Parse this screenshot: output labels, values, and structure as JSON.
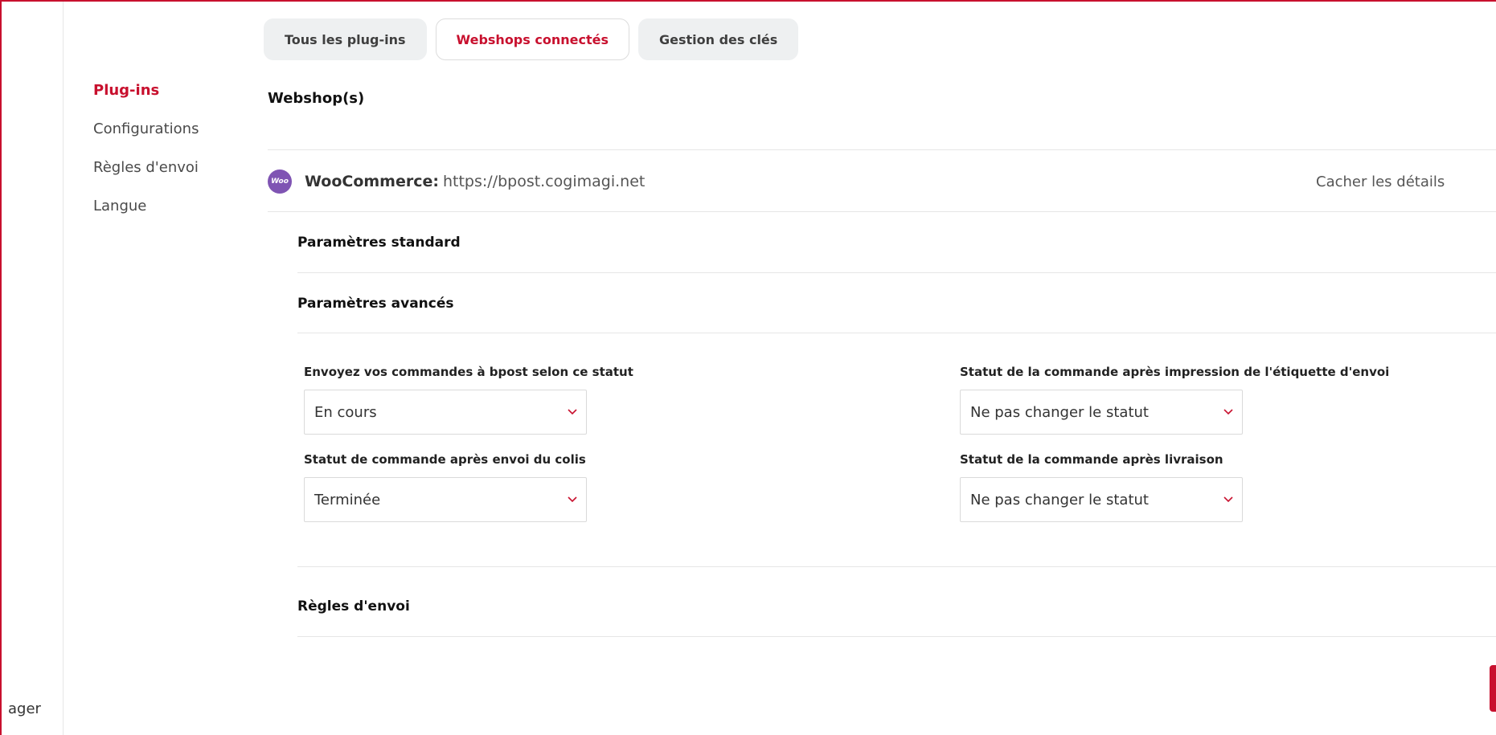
{
  "left_rail": {
    "text": "ager"
  },
  "subnav": {
    "items": [
      {
        "label": "Plug-ins",
        "active": true
      },
      {
        "label": "Configurations",
        "active": false
      },
      {
        "label": "Règles d'envoi",
        "active": false
      },
      {
        "label": "Langue",
        "active": false
      }
    ]
  },
  "tabs": [
    {
      "label": "Tous les plug-ins",
      "active": false
    },
    {
      "label": "Webshops connectés",
      "active": true
    },
    {
      "label": "Gestion des clés",
      "active": false
    }
  ],
  "webshops": {
    "title": "Webshop(s)",
    "shop": {
      "logo_text": "Woo",
      "platform": "WooCommerce:",
      "url": "https://bpost.cogimagi.net",
      "toggle_label": "Cacher les détails"
    }
  },
  "sections": {
    "standard": "Paramètres standard",
    "advanced": "Paramètres avancés",
    "rules": "Règles d'envoi"
  },
  "advanced_fields": {
    "send_status": {
      "label": "Envoyez vos commandes à bpost selon ce statut",
      "value": "En cours"
    },
    "after_print": {
      "label": "Statut de la commande après impression de l'étiquette d'envoi",
      "value": "Ne pas changer le statut"
    },
    "after_send": {
      "label": "Statut de commande après envoi du colis",
      "value": "Terminée"
    },
    "after_delivery": {
      "label": "Statut de la commande après livraison",
      "value": "Ne pas changer le statut"
    }
  },
  "colors": {
    "accent": "#c8102e",
    "woo_purple": "#7f54b3"
  }
}
